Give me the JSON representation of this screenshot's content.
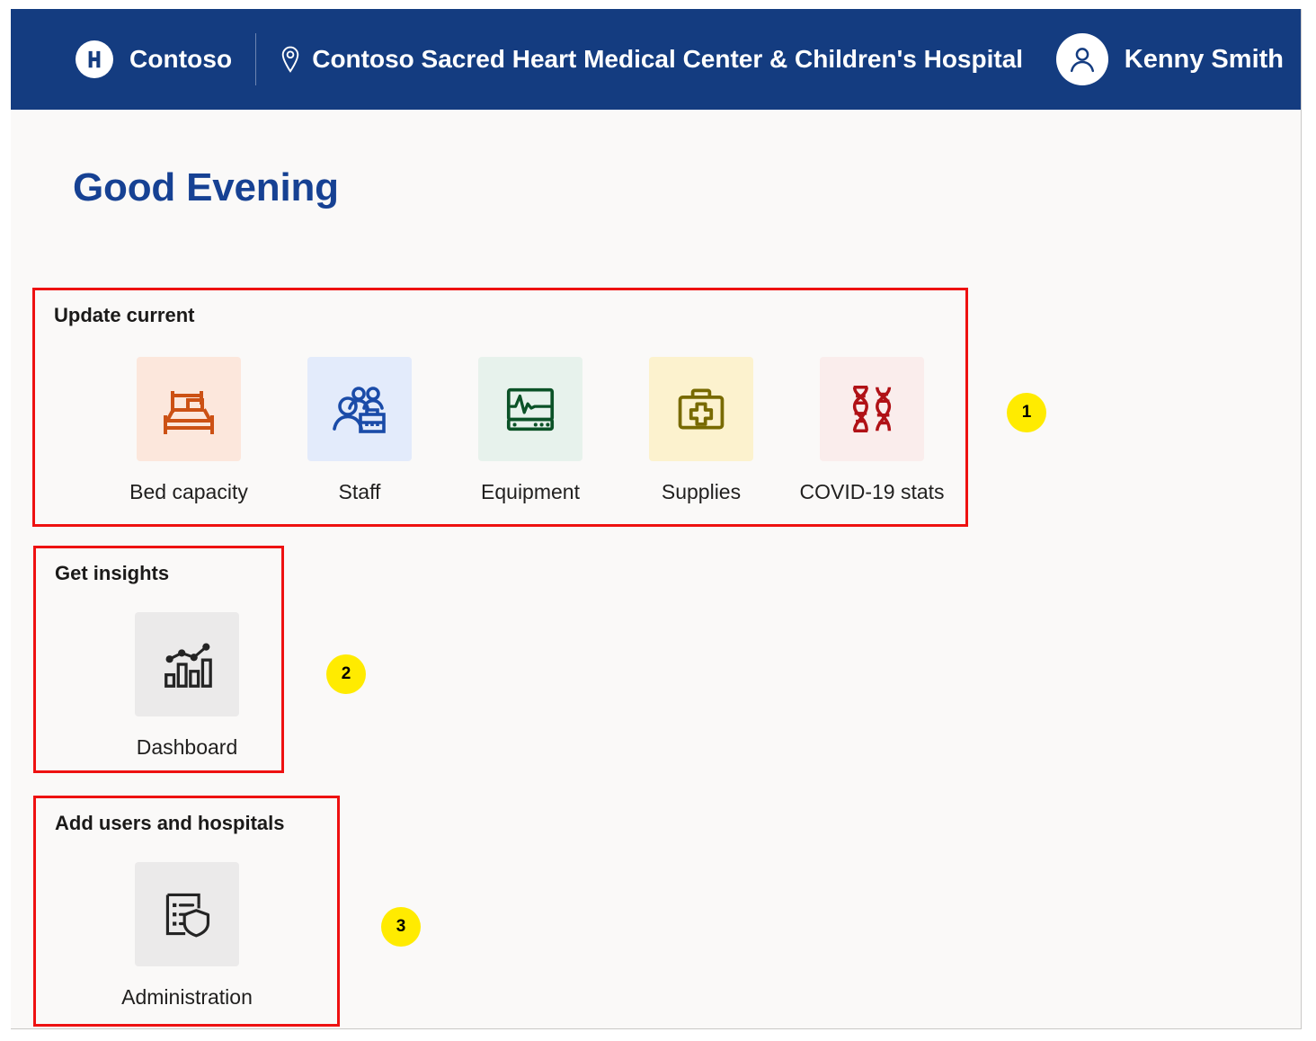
{
  "topbar": {
    "brand_logo_icon": "hospital-h-logo-icon",
    "brand_name": "Contoso",
    "location_pin_icon": "location-pin-icon",
    "site_name": "Contoso Sacred Heart Medical Center & Children's Hospital",
    "avatar_icon": "user-avatar-icon",
    "user_name": "Kenny Smith"
  },
  "page": {
    "greeting": "Good Evening"
  },
  "sections": [
    {
      "title": "Update current",
      "tiles": [
        {
          "label": "Bed capacity",
          "icon": "bed-icon",
          "bg": "#fce7dc",
          "fg": "#cc5114"
        },
        {
          "label": "Staff",
          "icon": "staff-people-icon",
          "bg": "#e3ebfb",
          "fg": "#1a4ba8"
        },
        {
          "label": "Equipment",
          "icon": "vitals-monitor-icon",
          "bg": "#e7f2ec",
          "fg": "#0b5227"
        },
        {
          "label": "Supplies",
          "icon": "first-aid-kit-icon",
          "bg": "#fcf2ce",
          "fg": "#786a00"
        },
        {
          "label": "COVID-19 stats",
          "icon": "dna-helix-icon",
          "bg": "#faedec",
          "fg": "#b01116"
        }
      ]
    },
    {
      "title": "Get insights",
      "tiles": [
        {
          "label": "Dashboard",
          "icon": "bar-chart-trend-icon",
          "bg": "#ebeaea",
          "fg": "#242424"
        }
      ]
    },
    {
      "title": "Add users and hospitals",
      "tiles": [
        {
          "label": "Administration",
          "icon": "document-shield-icon",
          "bg": "#ebeaea",
          "fg": "#242424"
        }
      ]
    }
  ],
  "callouts": [
    {
      "number": "1"
    },
    {
      "number": "2"
    },
    {
      "number": "3"
    }
  ],
  "colors": {
    "header_blue": "#143c80",
    "greeting_blue": "#164193",
    "page_background": "#faf9f8",
    "annotation_red": "#ee1111",
    "callout_yellow": "#ffeb00"
  }
}
